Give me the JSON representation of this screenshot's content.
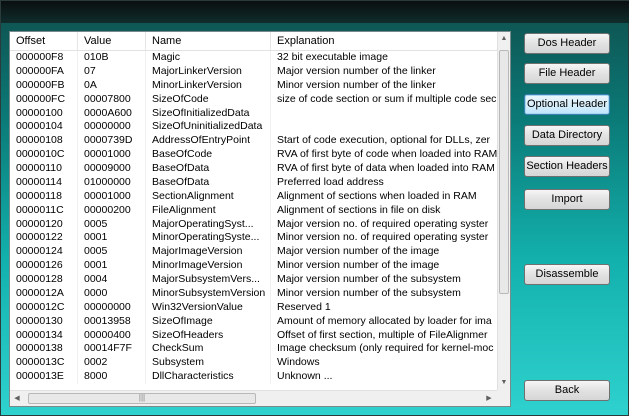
{
  "columns": [
    "Offset",
    "Value",
    "Name",
    "Explanation"
  ],
  "rows": [
    [
      "000000F8",
      "010B",
      "Magic",
      "32 bit executable image"
    ],
    [
      "000000FA",
      "07",
      "MajorLinkerVersion",
      "Major version number of the linker"
    ],
    [
      "000000FB",
      "0A",
      "MinorLinkerVersion",
      "Minor version number of the linker"
    ],
    [
      "000000FC",
      "00007800",
      "SizeOfCode",
      "size of code section or sum if multiple code sec"
    ],
    [
      "00000100",
      "0000A600",
      "SizeOfInitializedData",
      ""
    ],
    [
      "00000104",
      "00000000",
      "SizeOfUninitializedData",
      ""
    ],
    [
      "00000108",
      "0000739D",
      "AddressOfEntryPoint",
      "Start of code execution, optional for DLLs, zer"
    ],
    [
      "0000010C",
      "00001000",
      "BaseOfCode",
      "RVA of first byte of code when loaded into RAM"
    ],
    [
      "00000110",
      "00009000",
      "BaseOfData",
      "RVA of first byte of data when loaded into RAM"
    ],
    [
      "00000114",
      "01000000",
      "BaseOfData",
      "Preferred load address"
    ],
    [
      "00000118",
      "00001000",
      "SectionAlignment",
      "Alignment of sections when loaded in RAM"
    ],
    [
      "0000011C",
      "00000200",
      "FileAlignment",
      "Alignment of sections in file on disk"
    ],
    [
      "00000120",
      "0005",
      "MajorOperatingSyst...",
      "Major version no. of required operating syster"
    ],
    [
      "00000122",
      "0001",
      "MinorOperatingSyste...",
      "Minor version no. of required operating syster"
    ],
    [
      "00000124",
      "0005",
      "MajorImageVersion",
      "Major version number of the image"
    ],
    [
      "00000126",
      "0001",
      "MinorImageVersion",
      "Minor version number of the image"
    ],
    [
      "00000128",
      "0004",
      "MajorSubsystemVers...",
      "Major version number of the subsystem"
    ],
    [
      "0000012A",
      "0000",
      "MinorSubsystemVersion",
      "Minor version number of the subsystem"
    ],
    [
      "0000012C",
      "00000000",
      "Win32VersionValue",
      "Reserved 1"
    ],
    [
      "00000130",
      "00013958",
      "SizeOfImage",
      "Amount of memory allocated by loader for ima"
    ],
    [
      "00000134",
      "00000400",
      "SizeOfHeaders",
      "Offset of first section, multiple of FileAlignmer"
    ],
    [
      "00000138",
      "00014F7F",
      "CheckSum",
      "Image checksum (only required for kernel-moc"
    ],
    [
      "0000013C",
      "0002",
      "Subsystem",
      "Windows"
    ],
    [
      "0000013E",
      "8000",
      "DllCharacteristics",
      "Unknown ..."
    ]
  ],
  "scrollbar": {
    "up": "▲",
    "down": "▼",
    "left": "◀",
    "right": "▶",
    "grip": "|||"
  },
  "buttons": {
    "dos_header": "Dos Header",
    "file_header": "File Header",
    "optional_header": "Optional Header",
    "data_directory": "Data Directory",
    "section_headers": "Section Headers",
    "import": "Import",
    "disassemble": "Disassemble",
    "back": "Back"
  }
}
